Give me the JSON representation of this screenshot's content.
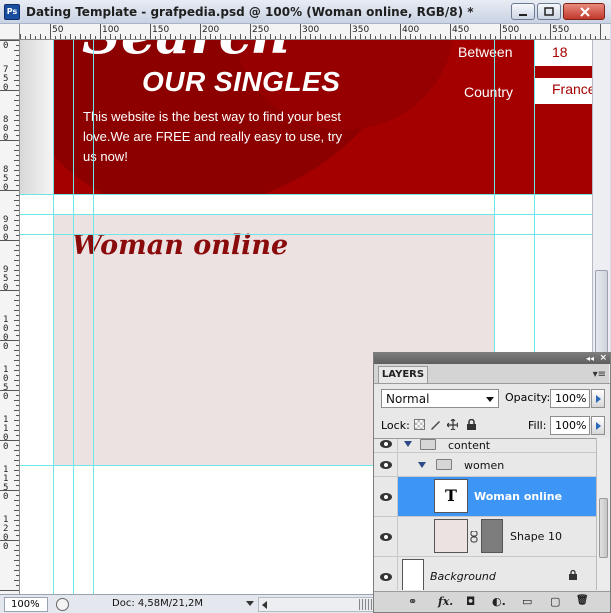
{
  "window": {
    "title": "Dating Template - grafpedia.psd @ 100% (Woman online, RGB/8) *",
    "app_icon": "Ps"
  },
  "rulers": {
    "top_labels": [
      "50",
      "100",
      "150",
      "200",
      "250",
      "300",
      "350",
      "400",
      "450",
      "500",
      "550"
    ],
    "left_labels": [
      "0",
      "750",
      "800",
      "850",
      "900",
      "950",
      "1000",
      "1050",
      "1100",
      "1150",
      "1200"
    ]
  },
  "canvas": {
    "search_word": "Search",
    "our_singles": "OUR SINGLES",
    "tagline": "This website is the best way to find your best love.We are FREE and really easy to use, try us now!",
    "between_label": "Between",
    "between_value": "18",
    "country_label": "Country",
    "country_value": "France",
    "woman_online_title": "Woman online",
    "colors": {
      "banner": "#a40000",
      "panel": "#ede2e2",
      "title": "#8a0b0b",
      "guides": "#6fe6ea"
    }
  },
  "status": {
    "zoom": "100%",
    "doc_info": "Doc: 4,58M/21,2M"
  },
  "layers_panel": {
    "tab_label": "LAYERS",
    "blend_mode": "Normal",
    "opacity_label": "Opacity:",
    "opacity_value": "100%",
    "lock_label": "Lock:",
    "fill_label": "Fill:",
    "fill_value": "100%",
    "layers": [
      {
        "name": "content",
        "type": "group"
      },
      {
        "name": "women",
        "type": "group"
      },
      {
        "name": "Woman online",
        "type": "text",
        "thumb": "T",
        "selected": true
      },
      {
        "name": "Shape 10",
        "type": "shape"
      },
      {
        "name": "Background",
        "type": "background",
        "locked": true
      }
    ],
    "bottom_icons": [
      "link-icon",
      "fx-icon",
      "mask-icon",
      "adjustment-icon",
      "folder-icon",
      "new-layer-icon",
      "trash-icon"
    ],
    "bottom_glyphs": [
      "⚭",
      "fx.",
      "◘",
      "◐.",
      "▭",
      "▢",
      "🗑"
    ]
  }
}
